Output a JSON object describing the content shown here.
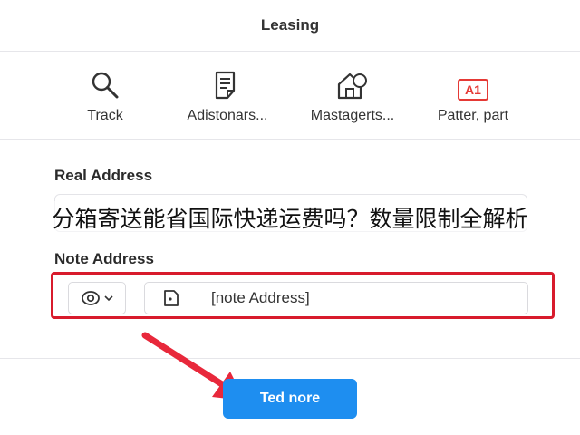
{
  "header": {
    "title": "Leasing"
  },
  "toolbar": {
    "items": [
      {
        "label": "Track",
        "icon": "search-icon"
      },
      {
        "label": "Adistonars...",
        "icon": "document-icon"
      },
      {
        "label": "Mastagerts...",
        "icon": "house-icon"
      },
      {
        "label": "Patter, part",
        "icon": "a1-badge-icon",
        "badge": "A1"
      }
    ]
  },
  "real_address": {
    "label": "Real Address",
    "value": ""
  },
  "overlay_caption": "分箱寄送能省国际快递运费吗？数量限制全解析",
  "note_address": {
    "label": "Note Address",
    "value": "[note Address]"
  },
  "primary_button": {
    "label": "Ted nore"
  },
  "colors": {
    "accent": "#1e8ef0",
    "highlight": "#d81b2c"
  }
}
